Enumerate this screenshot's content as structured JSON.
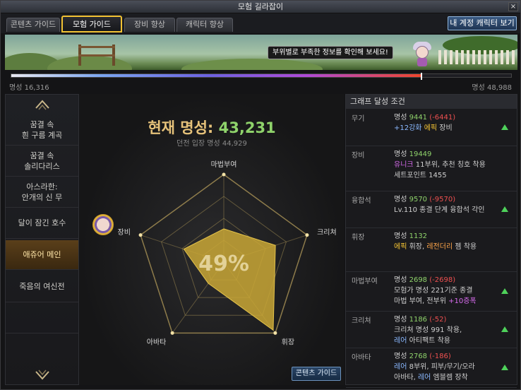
{
  "window": {
    "title": "모험 길라잡이",
    "close_label": "×"
  },
  "tabs": [
    {
      "label": "콘텐츠 가이드",
      "active": false
    },
    {
      "label": "모험 가이드",
      "active": true
    },
    {
      "label": "장비 향상",
      "active": false
    },
    {
      "label": "캐릭터 향상",
      "active": false
    }
  ],
  "account_button": "내 계정 캐릭터 보기",
  "banner": {
    "tooltip": "부위별로 부족한 정보를 확인해 보세요!"
  },
  "progress": {
    "min_label": "명성 16,316",
    "max_label": "명성 48,988",
    "fraction": 0.82
  },
  "sidebar": {
    "items": [
      {
        "label": "꿈결 속\n흰 구름 계곡"
      },
      {
        "label": "꿈결 속\n솔리다리스"
      },
      {
        "label": "아스라한:\n안개의 신 무"
      },
      {
        "label": "달이 잠긴 호수"
      },
      {
        "label": "애쥬어 메인"
      },
      {
        "label": "죽음의 여신전"
      }
    ],
    "active_index": 4
  },
  "summary": {
    "title_prefix": "현재 명성:",
    "title_value": "43,231",
    "dungeon_line": "던전 입장 명성 44,929",
    "percent": "49%",
    "guide_button": "콘텐츠 가이드"
  },
  "radar": {
    "axes": [
      "마법부여",
      "크리쳐",
      "휘장",
      "아바타",
      "장비"
    ],
    "levels": 4,
    "values": [
      0.38,
      0.62,
      0.96,
      0.3,
      0.48
    ],
    "fill_color": "#c9a736",
    "grid_color": "#9a8650"
  },
  "conditions": {
    "header": "그래프 달성 조건",
    "rows": [
      {
        "label": "무기",
        "lines": [
          [
            {
              "t": "명성 "
            },
            {
              "t": "9441",
              "c": "g"
            },
            {
              "t": " "
            },
            {
              "t": "(-6441)",
              "c": "r"
            }
          ],
          [
            {
              "t": "+12강화",
              "c": "b"
            },
            {
              "t": " "
            },
            {
              "t": "에픽",
              "c": "y"
            },
            {
              "t": " 장비"
            }
          ]
        ],
        "arrow": true
      },
      {
        "label": "장비",
        "lines": [
          [
            {
              "t": "명성 "
            },
            {
              "t": "19449",
              "c": "g"
            }
          ],
          [
            {
              "t": "유니크",
              "c": "p"
            },
            {
              "t": " 11부위, 추천 칭호 착용"
            }
          ],
          [
            {
              "t": "세트포인트 1455"
            }
          ]
        ],
        "arrow": false
      },
      {
        "label": "융합석",
        "lines": [
          [
            {
              "t": "명성 "
            },
            {
              "t": "9570",
              "c": "g"
            },
            {
              "t": " "
            },
            {
              "t": "(-9570)",
              "c": "r"
            }
          ],
          [
            {
              "t": "Lv.110 종결 단계 융합석 각인"
            }
          ]
        ],
        "arrow": true
      },
      {
        "label": "휘장",
        "lines": [
          [
            {
              "t": "명성 "
            },
            {
              "t": "1132",
              "c": "g"
            }
          ],
          [
            {
              "t": "에픽",
              "c": "y"
            },
            {
              "t": " 휘장, "
            },
            {
              "t": "레전더리",
              "c": "o"
            },
            {
              "t": " 젬 착용"
            }
          ]
        ],
        "arrow": false
      },
      {
        "label": "마법부여",
        "lines": [
          [
            {
              "t": "명성 "
            },
            {
              "t": "2698",
              "c": "g"
            },
            {
              "t": " "
            },
            {
              "t": "(-2698)",
              "c": "r"
            }
          ],
          [
            {
              "t": "모험가 명성 221기준 종결"
            }
          ],
          [
            {
              "t": "마법 부여, 전부위 "
            },
            {
              "t": "+10증폭",
              "c": "p"
            }
          ]
        ],
        "arrow": true
      },
      {
        "label": "크리쳐",
        "lines": [
          [
            {
              "t": "명성 "
            },
            {
              "t": "1186",
              "c": "g"
            },
            {
              "t": " "
            },
            {
              "t": "(-52)",
              "c": "r"
            }
          ],
          [
            {
              "t": "크리쳐 명성 991 착용,"
            }
          ],
          [
            {
              "t": "레어",
              "c": "b"
            },
            {
              "t": " 아티팩트 착용"
            }
          ]
        ],
        "arrow": true
      },
      {
        "label": "아바타",
        "lines": [
          [
            {
              "t": "명성 "
            },
            {
              "t": "2768",
              "c": "g"
            },
            {
              "t": " "
            },
            {
              "t": "(-186)",
              "c": "r"
            }
          ],
          [
            {
              "t": "레어",
              "c": "b"
            },
            {
              "t": " 8부위, 피부/무기/오라"
            }
          ],
          [
            {
              "t": "아바타, "
            },
            {
              "t": "레어",
              "c": "b"
            },
            {
              "t": " 엠블렘 장착"
            }
          ]
        ],
        "arrow": true
      }
    ]
  }
}
